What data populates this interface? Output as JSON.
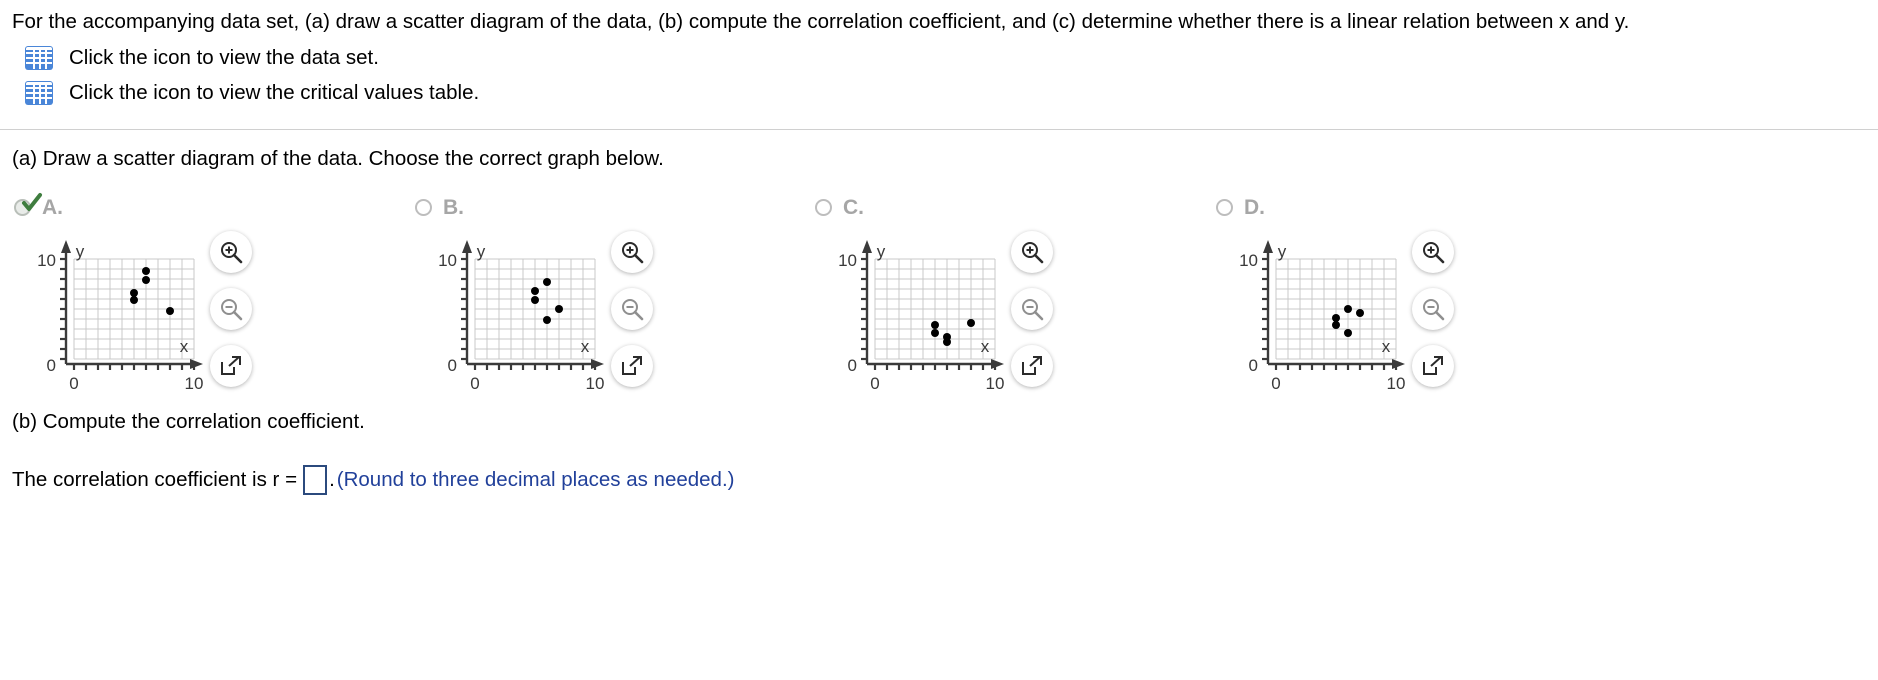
{
  "problem": {
    "statement": "For the accompanying data set, (a) draw a scatter diagram of the data, (b) compute the correlation coefficient, and (c) determine whether there is a linear relation between x and y.",
    "links": [
      {
        "icon": "table-icon",
        "label": "Click the icon to view the data set."
      },
      {
        "icon": "table-icon",
        "label": "Click the icon to view the critical values table."
      }
    ]
  },
  "part_a": {
    "prompt": "(a) Draw a scatter diagram of the data. Choose the correct graph below.",
    "selected": "A",
    "options": [
      {
        "letter": "A.",
        "selected": true
      },
      {
        "letter": "B.",
        "selected": false
      },
      {
        "letter": "C.",
        "selected": false
      },
      {
        "letter": "D.",
        "selected": false
      }
    ]
  },
  "part_b": {
    "prompt": "(b) Compute the correlation coefficient.",
    "answer_prefix": "The correlation coefficient is r =",
    "answer_value": "",
    "answer_suffix": ".",
    "hint": "(Round to three decimal places as needed.)"
  },
  "tools": [
    {
      "name": "zoom-in-icon",
      "label": "Zoom in"
    },
    {
      "name": "zoom-out-icon",
      "label": "Zoom out"
    },
    {
      "name": "expand-icon",
      "label": "Open in new window"
    }
  ],
  "colors": {
    "icon_blue": "#4a86d8",
    "hint_blue": "#21409a",
    "answer_border": "#2b4a7d",
    "radio_gray": "#bdbdbd",
    "letter_gray": "#a6a6a6",
    "check_green": "#3f7d3f",
    "grid": "#c9c9c9",
    "axis": "#3a3a3a",
    "point": "#000000"
  },
  "chart_data": [
    {
      "type": "scatter",
      "id": "A",
      "title": "A.",
      "xlabel": "x",
      "ylabel": "y",
      "xlim": [
        0,
        10
      ],
      "ylim": [
        0,
        10
      ],
      "xticks": [
        0,
        10
      ],
      "yticks": [
        0,
        10
      ],
      "xtick_labels": [
        "0",
        "10"
      ],
      "ytick_labels": [
        "0",
        "10"
      ],
      "grid": true,
      "minor_step": 1,
      "points": [
        {
          "x": 5.0,
          "y": 5.9
        },
        {
          "x": 5.0,
          "y": 6.6
        },
        {
          "x": 6.0,
          "y": 7.9
        },
        {
          "x": 6.0,
          "y": 8.8
        },
        {
          "x": 8.0,
          "y": 4.8
        }
      ]
    },
    {
      "type": "scatter",
      "id": "B",
      "title": "B.",
      "xlabel": "x",
      "ylabel": "y",
      "xlim": [
        0,
        10
      ],
      "ylim": [
        0,
        10
      ],
      "xticks": [
        0,
        10
      ],
      "yticks": [
        0,
        10
      ],
      "xtick_labels": [
        "0",
        "10"
      ],
      "ytick_labels": [
        "0",
        "10"
      ],
      "grid": true,
      "minor_step": 1,
      "points": [
        {
          "x": 5.0,
          "y": 5.9
        },
        {
          "x": 5.0,
          "y": 6.8
        },
        {
          "x": 6.0,
          "y": 7.7
        },
        {
          "x": 6.0,
          "y": 3.9
        },
        {
          "x": 7.0,
          "y": 5.0
        }
      ]
    },
    {
      "type": "scatter",
      "id": "C",
      "title": "C.",
      "xlabel": "x",
      "ylabel": "y",
      "xlim": [
        0,
        10
      ],
      "ylim": [
        0,
        10
      ],
      "xticks": [
        0,
        10
      ],
      "yticks": [
        0,
        10
      ],
      "xtick_labels": [
        "0",
        "10"
      ],
      "ytick_labels": [
        "0",
        "10"
      ],
      "grid": true,
      "minor_step": 1,
      "points": [
        {
          "x": 5.0,
          "y": 3.4
        },
        {
          "x": 5.0,
          "y": 2.6
        },
        {
          "x": 6.0,
          "y": 1.7
        },
        {
          "x": 6.0,
          "y": 2.2
        },
        {
          "x": 8.0,
          "y": 3.6
        }
      ]
    },
    {
      "type": "scatter",
      "id": "D",
      "title": "D.",
      "xlabel": "x",
      "ylabel": "y",
      "xlim": [
        0,
        10
      ],
      "ylim": [
        0,
        10
      ],
      "xticks": [
        0,
        10
      ],
      "yticks": [
        0,
        10
      ],
      "xtick_labels": [
        "0",
        "10"
      ],
      "ytick_labels": [
        "0",
        "10"
      ],
      "grid": true,
      "minor_step": 1,
      "points": [
        {
          "x": 5.0,
          "y": 4.1
        },
        {
          "x": 5.0,
          "y": 3.4
        },
        {
          "x": 6.0,
          "y": 5.0
        },
        {
          "x": 6.0,
          "y": 2.6
        },
        {
          "x": 7.0,
          "y": 4.6
        }
      ]
    }
  ]
}
